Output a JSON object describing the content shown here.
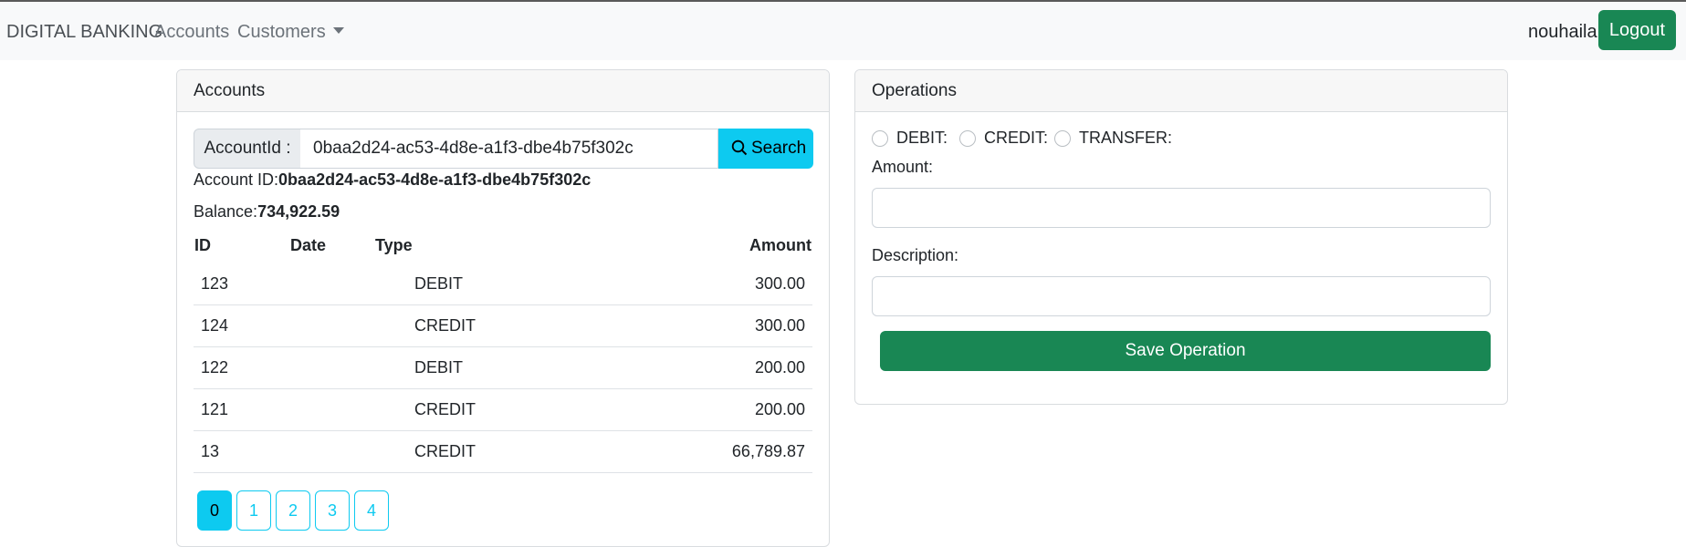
{
  "navbar": {
    "brand": "DIGITAL BANKING",
    "links": {
      "accounts": "Accounts",
      "customers": "Customers"
    },
    "username": "nouhaila",
    "logout_label": "Logout"
  },
  "accounts_card": {
    "title": "Accounts",
    "search": {
      "label": "AccountId :",
      "value": "0baa2d24-ac53-4d8e-a1f3-dbe4b75f302c",
      "button_label": "Search",
      "button_icon": "search-icon"
    },
    "account_id_label": "Account ID:",
    "account_id_value": "0baa2d24-ac53-4d8e-a1f3-dbe4b75f302c",
    "balance_label": "Balance:",
    "balance_value": "734,922.59",
    "table": {
      "headers": {
        "id": "ID",
        "date": "Date",
        "type": "Type",
        "amount": "Amount"
      },
      "rows": [
        {
          "id": "123",
          "date": "",
          "type": "DEBIT",
          "amount": "300.00"
        },
        {
          "id": "124",
          "date": "",
          "type": "CREDIT",
          "amount": "300.00"
        },
        {
          "id": "122",
          "date": "",
          "type": "DEBIT",
          "amount": "200.00"
        },
        {
          "id": "121",
          "date": "",
          "type": "CREDIT",
          "amount": "200.00"
        },
        {
          "id": "13",
          "date": "",
          "type": "CREDIT",
          "amount": "66,789.87"
        }
      ]
    },
    "pagination": {
      "pages": [
        "0",
        "1",
        "2",
        "3",
        "4"
      ],
      "current": "0"
    }
  },
  "operations_card": {
    "title": "Operations",
    "radios": {
      "debit": "DEBIT:",
      "credit": "CREDIT:",
      "transfer": "TRANSFER:"
    },
    "amount_label": "Amount:",
    "amount_value": "",
    "description_label": "Description:",
    "description_value": "",
    "save_label": "Save Operation"
  },
  "colors": {
    "primary_green": "#198754",
    "info_cyan": "#0dcaf0",
    "navbar_bg": "#f8f9fa"
  }
}
